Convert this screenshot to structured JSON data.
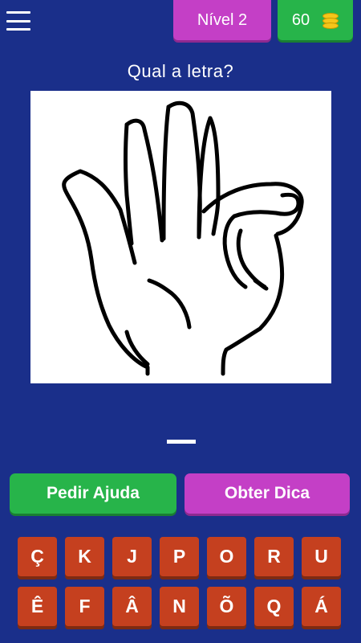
{
  "header": {
    "level_label": "Nível 2",
    "coins": "60"
  },
  "question": "Qual a letra?",
  "actions": {
    "help_label": "Pedir Ajuda",
    "hint_label": "Obter Dica"
  },
  "keyboard": {
    "row1": [
      "Ç",
      "K",
      "J",
      "P",
      "O",
      "R",
      "U"
    ],
    "row2": [
      "Ê",
      "F",
      "Â",
      "N",
      "Õ",
      "Q",
      "Á"
    ]
  },
  "colors": {
    "background": "#1a2f8a",
    "level": "#c43fc6",
    "coins": "#27b44a",
    "key": "#c5401f"
  }
}
